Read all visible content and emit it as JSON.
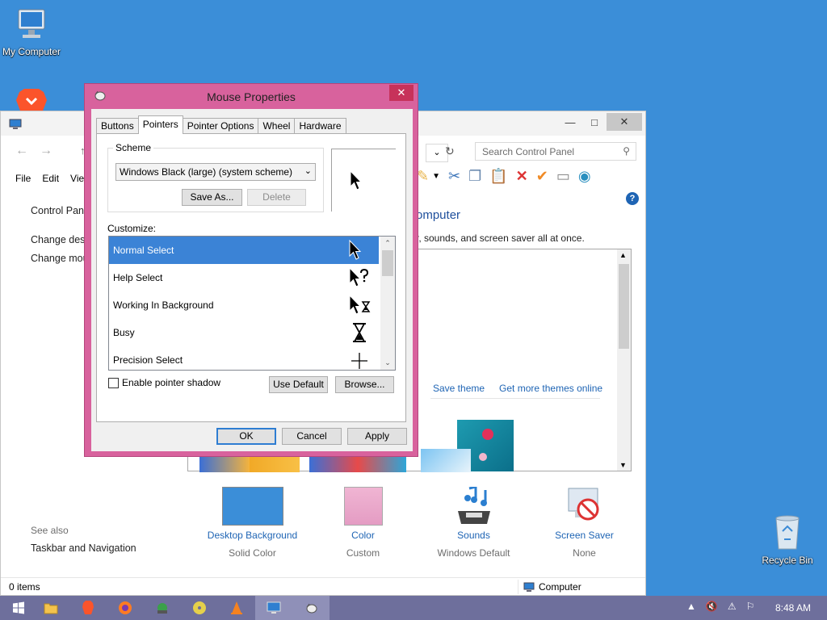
{
  "desktop": {
    "my_computer": "My Computer",
    "recycle_bin": "Recycle Bin"
  },
  "control_panel": {
    "search_placeholder": "Search Control Panel",
    "menu": [
      "File",
      "Edit",
      "Vie"
    ],
    "left_pane": {
      "home": "Control Panel",
      "link1": "Change desk",
      "link2": "Change mou"
    },
    "heading": "omputer",
    "subheading": "r, sounds, and screen saver all at once.",
    "theme_links": {
      "save": "Save theme",
      "more": "Get more themes online"
    },
    "bottom_items": [
      {
        "link": "Desktop Background",
        "sub": "Solid Color",
        "color": "#3b8ed8"
      },
      {
        "link": "Color",
        "sub": "Custom",
        "color": "#e8a1c9"
      },
      {
        "link": "Sounds",
        "sub": "Windows Default"
      },
      {
        "link": "Screen Saver",
        "sub": "None"
      }
    ],
    "see_also": {
      "heading": "See also",
      "link": "Taskbar and Navigation"
    },
    "status": {
      "items": "0 items",
      "location": "Computer"
    }
  },
  "dialog": {
    "title": "Mouse Properties",
    "tabs": [
      "Buttons",
      "Pointers",
      "Pointer Options",
      "Wheel",
      "Hardware"
    ],
    "scheme_label": "Scheme",
    "scheme_value": "Windows Black (large) (system scheme)",
    "save_as": "Save As...",
    "delete": "Delete",
    "customize_label": "Customize:",
    "pointers": [
      {
        "name": "Normal Select",
        "icon": "arrow-cursor"
      },
      {
        "name": "Help Select",
        "icon": "help-cursor"
      },
      {
        "name": "Working In Background",
        "icon": "working-cursor"
      },
      {
        "name": "Busy",
        "icon": "hourglass-cursor"
      },
      {
        "name": "Precision Select",
        "icon": "crosshair-cursor"
      }
    ],
    "enable_shadow": "Enable pointer shadow",
    "use_default": "Use Default",
    "browse": "Browse...",
    "ok": "OK",
    "cancel": "Cancel",
    "apply": "Apply"
  },
  "taskbar": {
    "time": "8:48 AM"
  }
}
